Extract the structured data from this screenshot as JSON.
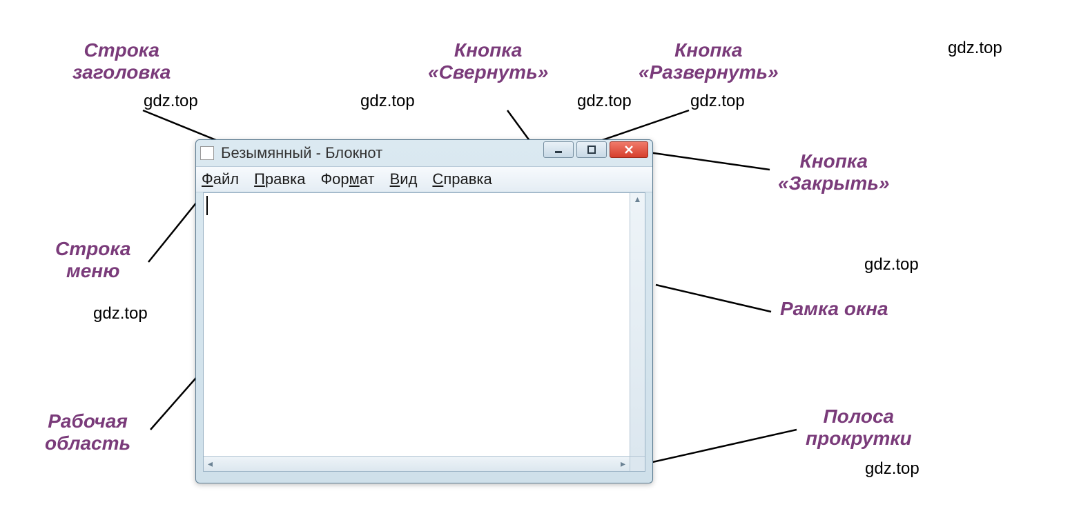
{
  "labels": {
    "title_bar": "Строка\nзаголовка",
    "minimize_btn": "Кнопка\n«Свернуть»",
    "maximize_btn": "Кнопка\n«Развернуть»",
    "close_btn": "Кнопка\n«Закрыть»",
    "menu_bar": "Строка\nменю",
    "frame": "Рамка окна",
    "work_area": "Рабочая\nобласть",
    "scrollbar": "Полоса\nпрокрутки"
  },
  "watermark": "gdz.top",
  "window": {
    "title": "Безымянный - Блокнот",
    "menu": [
      "Файл",
      "Правка",
      "Формат",
      "Вид",
      "Справка"
    ],
    "menu_mnemonics": [
      0,
      0,
      3,
      0,
      0
    ]
  }
}
